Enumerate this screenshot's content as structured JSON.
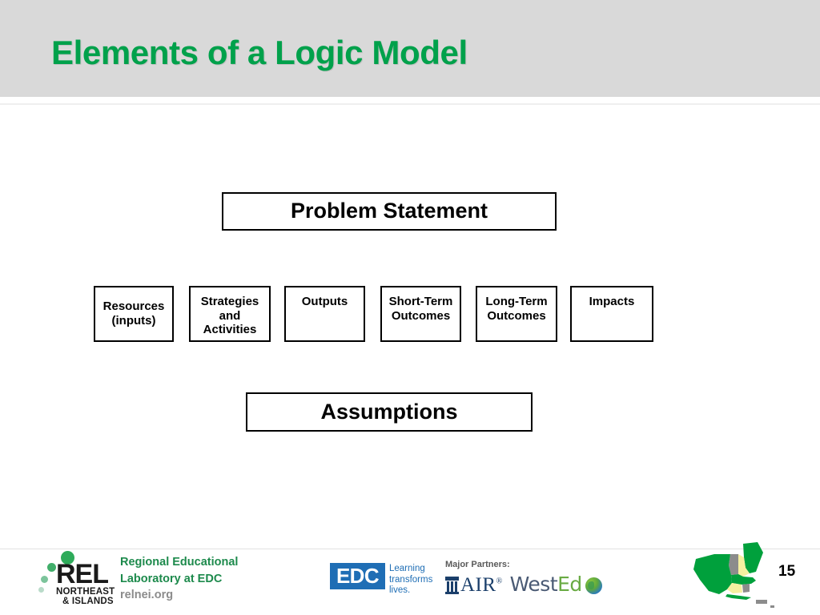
{
  "slide": {
    "title": "Elements of a Logic Model",
    "page_number": "15",
    "title_color": "#00a14b",
    "header_bg": "#d9d9d9"
  },
  "diagram": {
    "problem_statement": "Problem Statement",
    "assumptions": "Assumptions",
    "components": [
      {
        "line1": "Resources",
        "line2": "(inputs)",
        "line3": ""
      },
      {
        "line1": "Strategies",
        "line2": "and",
        "line3": "Activities"
      },
      {
        "line1": "Outputs",
        "line2": "",
        "line3": ""
      },
      {
        "line1": "Short-Term",
        "line2": "Outcomes",
        "line3": ""
      },
      {
        "line1": "Long-Term",
        "line2": "Outcomes",
        "line3": ""
      },
      {
        "line1": "Impacts",
        "line2": "",
        "line3": ""
      }
    ]
  },
  "footer": {
    "rel": {
      "acronym": "REL",
      "region_line1": "NORTHEAST",
      "region_line2": "& ISLANDS",
      "name_line1": "Regional Educational",
      "name_line2": "Laboratory at EDC",
      "website": "relnei.org",
      "green": "#1d8a4c"
    },
    "edc": {
      "mark": "EDC",
      "tagline_line1": "Learning",
      "tagline_line2": "transforms",
      "tagline_line3": "lives.",
      "blue": "#1f6eb5"
    },
    "partners": {
      "label": "Major Partners:",
      "air": "AIR",
      "air_mark": "®",
      "wested_part1": "West",
      "wested_part2": "Ed"
    },
    "map": {
      "region": "Northeast and Islands",
      "states": [
        {
          "name": "New York",
          "color": "#00a03c"
        },
        {
          "name": "Maine",
          "color": "#00a03c"
        },
        {
          "name": "Vermont",
          "color": "#8c8c8c"
        },
        {
          "name": "New Hampshire",
          "color": "#f5f0a0"
        },
        {
          "name": "Massachusetts",
          "color": "#00a03c"
        },
        {
          "name": "Connecticut",
          "color": "#f5f0a0"
        },
        {
          "name": "Rhode Island",
          "color": "#8c8c8c"
        },
        {
          "name": "Puerto Rico",
          "color": "#8c8c8c"
        }
      ]
    }
  }
}
